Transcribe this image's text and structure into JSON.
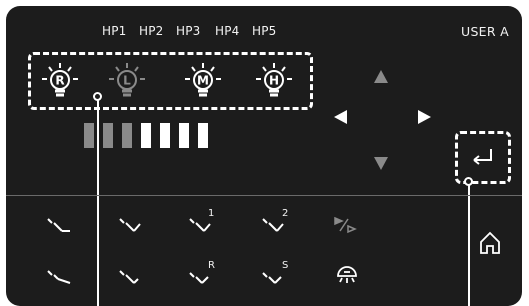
{
  "header": {
    "hp_labels": [
      "HP1",
      "HP2",
      "HP3",
      "HP4",
      "HP5"
    ],
    "user_label": "USER A"
  },
  "lamps": [
    {
      "letter": "R",
      "active": true
    },
    {
      "letter": "L",
      "active": false
    },
    {
      "letter": "M",
      "active": true
    },
    {
      "letter": "H",
      "active": true
    }
  ],
  "intensity": {
    "levels_total": 7,
    "levels_on": 4
  },
  "instruments": {
    "row1": [
      {
        "name": "instrument-1",
        "sub": ""
      },
      {
        "name": "instrument-2",
        "sub": ""
      },
      {
        "name": "instrument-3",
        "sub": "1"
      },
      {
        "name": "instrument-4",
        "sub": "2"
      },
      {
        "name": "play-forward",
        "sub": ""
      }
    ],
    "row2": [
      {
        "name": "instrument-5",
        "sub": ""
      },
      {
        "name": "instrument-6",
        "sub": ""
      },
      {
        "name": "instrument-7",
        "sub": "R"
      },
      {
        "name": "instrument-8",
        "sub": "S"
      },
      {
        "name": "light",
        "sub": ""
      }
    ]
  },
  "colors": {
    "panel": "#1c1c1c",
    "text": "#f2f2f2",
    "dim": "#8a8a8a",
    "accent": "#ffffff"
  }
}
